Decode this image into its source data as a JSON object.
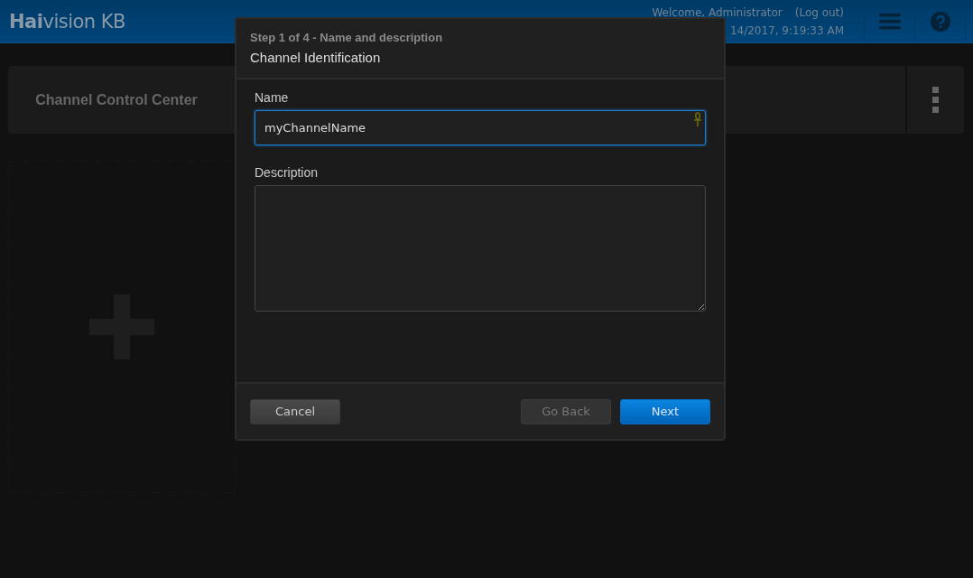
{
  "header": {
    "logo": "**Hai**vision KB",
    "welcome": "Welcome, Administrator",
    "logout": "(Log out)",
    "datetime": "14/2017, 9:19:33 AM"
  },
  "page": {
    "title": "Channel Control Center"
  },
  "dialog": {
    "step": "Step 1 of 4 - Name and description",
    "title": "Channel Identification",
    "fields": [
      {
        "kind": "input",
        "label": "Name",
        "value": "myChannelName",
        "focused": true
      },
      {
        "kind": "textarea",
        "label": "Description",
        "focused": false
      }
    ],
    "buttons": [
      {
        "label": "Cancel",
        "kind": "secondary",
        "disabled": false
      },
      {
        "label": "Go Back",
        "kind": "secondary",
        "disabled": true
      },
      {
        "label": "Next",
        "kind": "primary",
        "disabled": false
      }
    ]
  }
}
